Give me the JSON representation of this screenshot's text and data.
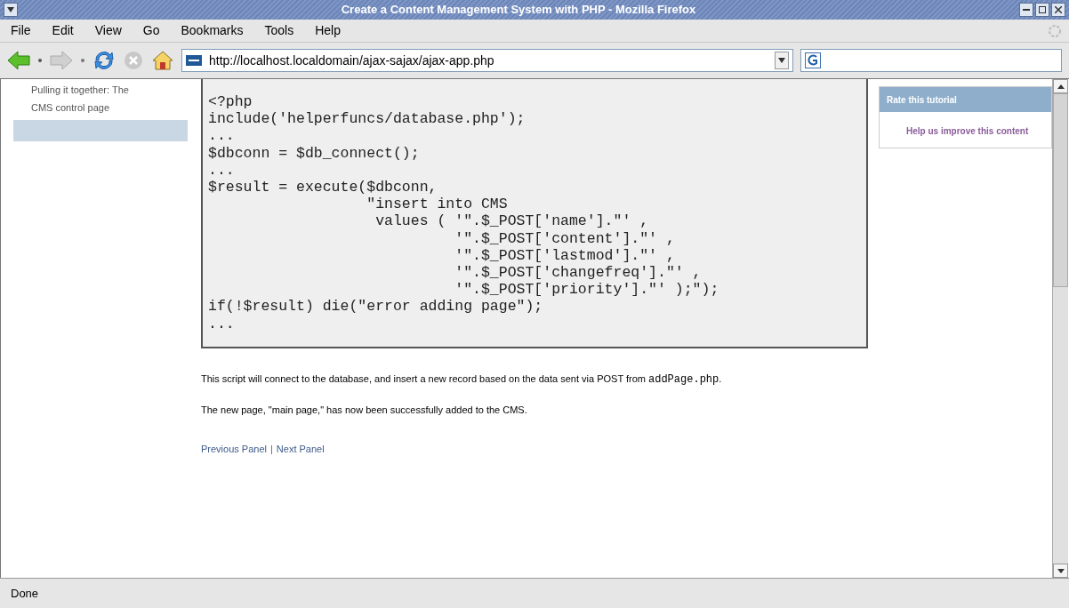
{
  "window": {
    "title": "Create a Content Management System with PHP - Mozilla Firefox"
  },
  "menu": [
    "File",
    "Edit",
    "View",
    "Go",
    "Bookmarks",
    "Tools",
    "Help"
  ],
  "address_bar": {
    "value": "http://localhost.localdomain/ajax-sajax/ajax-app.php"
  },
  "sidebar": {
    "lines": [
      "Pulling it together: The",
      "CMS control page"
    ]
  },
  "code": [
    "<?php",
    "include('helperfuncs/database.php');",
    "...",
    "$dbconn = $db_connect();",
    "...",
    "$result = execute($dbconn,",
    "                  \"insert into CMS",
    "                   values ( '\".$_POST['name'].\"' ,",
    "                            '\".$_POST['content'].\"' ,",
    "                            '\".$_POST['lastmod'].\"' ,",
    "                            '\".$_POST['changefreq'].\"' ,",
    "                            '\".$_POST['priority'].\"' );\");",
    "if(!$result) die(\"error adding page\");",
    "..."
  ],
  "paragraphs": [
    [
      {
        "kind": "text",
        "text": "This script will connect to the database, and insert a new record based on the data sent via POST from "
      },
      {
        "kind": "code",
        "text": "addPage.php"
      },
      {
        "kind": "text",
        "text": "."
      }
    ],
    [
      {
        "kind": "text",
        "text": "The new page, \"main page,\" has now been successfully added to the CMS."
      }
    ]
  ],
  "nav_links": [
    "Previous Panel",
    "|",
    "Next Panel"
  ],
  "rate_panel": {
    "title": "Rate this tutorial",
    "link": "Help us improve this content"
  },
  "status_bar": "Done"
}
